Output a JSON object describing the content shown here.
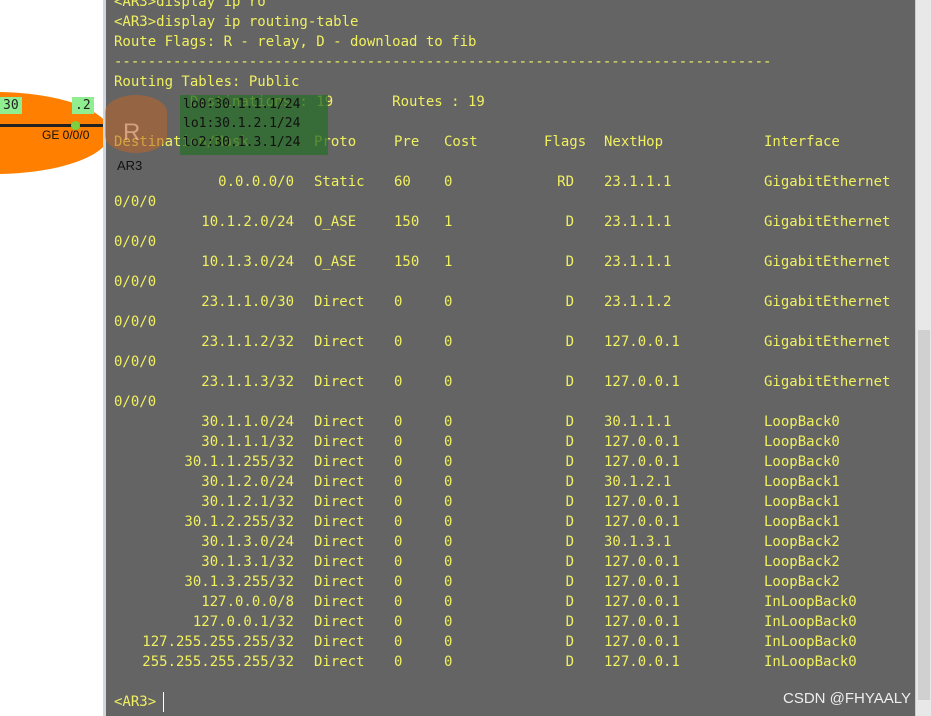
{
  "topology": {
    "left_label": "30",
    "right_label": ".2",
    "interface_label": "GE 0/0/0",
    "device_label": "AR3",
    "loopbacks": [
      "lo0:30.1.1.1/24",
      "lo1:30.1.2.1/24",
      "lo2:30.1.3.1/24"
    ]
  },
  "terminal": {
    "lines": [
      "<AR3>display ip ro",
      "<AR3>display ip routing-table",
      "Route Flags: R - relay, D - download to fib",
      "------------------------------------------------------------------------------",
      "Routing Tables: Public"
    ],
    "summary": "         Destinations : 19       Routes : 19",
    "headers": [
      "Destination/Mask",
      "Proto",
      "Pre",
      "Cost",
      "Flags",
      "NextHop",
      "Interface"
    ],
    "routes": [
      [
        "0.0.0.0/0",
        "Static",
        "60",
        "0",
        "RD",
        "23.1.1.1",
        "GigabitEthernet",
        "0/0/0"
      ],
      [
        "10.1.2.0/24",
        "O_ASE",
        "150",
        "1",
        "D",
        "23.1.1.1",
        "GigabitEthernet",
        "0/0/0"
      ],
      [
        "10.1.3.0/24",
        "O_ASE",
        "150",
        "1",
        "D",
        "23.1.1.1",
        "GigabitEthernet",
        "0/0/0"
      ],
      [
        "23.1.1.0/30",
        "Direct",
        "0",
        "0",
        "D",
        "23.1.1.2",
        "GigabitEthernet",
        "0/0/0"
      ],
      [
        "23.1.1.2/32",
        "Direct",
        "0",
        "0",
        "D",
        "127.0.0.1",
        "GigabitEthernet",
        "0/0/0"
      ],
      [
        "23.1.1.3/32",
        "Direct",
        "0",
        "0",
        "D",
        "127.0.0.1",
        "GigabitEthernet",
        "0/0/0"
      ],
      [
        "30.1.1.0/24",
        "Direct",
        "0",
        "0",
        "D",
        "30.1.1.1",
        "LoopBack0"
      ],
      [
        "30.1.1.1/32",
        "Direct",
        "0",
        "0",
        "D",
        "127.0.0.1",
        "LoopBack0"
      ],
      [
        "30.1.1.255/32",
        "Direct",
        "0",
        "0",
        "D",
        "127.0.0.1",
        "LoopBack0"
      ],
      [
        "30.1.2.0/24",
        "Direct",
        "0",
        "0",
        "D",
        "30.1.2.1",
        "LoopBack1"
      ],
      [
        "30.1.2.1/32",
        "Direct",
        "0",
        "0",
        "D",
        "127.0.0.1",
        "LoopBack1"
      ],
      [
        "30.1.2.255/32",
        "Direct",
        "0",
        "0",
        "D",
        "127.0.0.1",
        "LoopBack1"
      ],
      [
        "30.1.3.0/24",
        "Direct",
        "0",
        "0",
        "D",
        "30.1.3.1",
        "LoopBack2"
      ],
      [
        "30.1.3.1/32",
        "Direct",
        "0",
        "0",
        "D",
        "127.0.0.1",
        "LoopBack2"
      ],
      [
        "30.1.3.255/32",
        "Direct",
        "0",
        "0",
        "D",
        "127.0.0.1",
        "LoopBack2"
      ],
      [
        "127.0.0.0/8",
        "Direct",
        "0",
        "0",
        "D",
        "127.0.0.1",
        "InLoopBack0"
      ],
      [
        "127.0.0.1/32",
        "Direct",
        "0",
        "0",
        "D",
        "127.0.0.1",
        "InLoopBack0"
      ],
      [
        "127.255.255.255/32",
        "Direct",
        "0",
        "0",
        "D",
        "127.0.0.1",
        "InLoopBack0"
      ],
      [
        "255.255.255.255/32",
        "Direct",
        "0",
        "0",
        "D",
        "127.0.0.1",
        "InLoopBack0"
      ]
    ],
    "prompt": "<AR3>"
  },
  "watermark": "CSDN @FHYAALY",
  "colors": {
    "terminal_bg": "#646464",
    "terminal_text": "#f0f060",
    "link_orange": "#ff8000"
  }
}
